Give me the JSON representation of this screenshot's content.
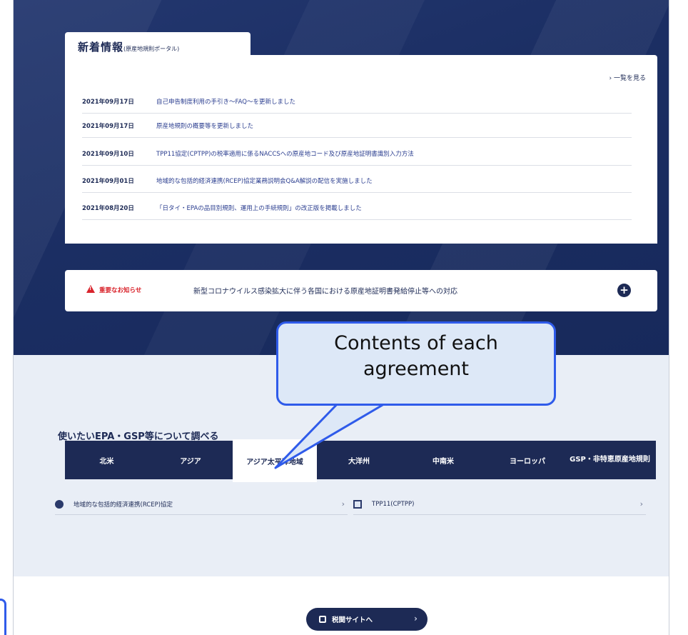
{
  "news": {
    "title": "新着情報",
    "subtitle": "(原産地規則ポータル)",
    "more_label": "› 一覧を見る",
    "items": [
      {
        "date": "2021年09月17日",
        "text": "自己申告制度利用の手引き～FAQ～を更新しました"
      },
      {
        "date": "2021年09月17日",
        "text": "原産地規則の概要等を更新しました"
      },
      {
        "date": "2021年09月10日",
        "text": "TPP11協定(CPTPP)の税率適用に係るNACCSへの原産地コード及び原産地証明書識別入力方法"
      },
      {
        "date": "2021年09月01日",
        "text": "地域的な包括的経済連携(RCEP)協定業務説明会Q&A解説の配信を実施しました"
      },
      {
        "date": "2021年08月20日",
        "text": "「日タイ・EPAの品目別規則、運用上の手続規則」の改正版を掲載しました"
      }
    ]
  },
  "notice": {
    "label": "重要なお知らせ",
    "text": "新型コロナウイルス感染拡大に伴う各国における原産地証明書発給停止等への対応",
    "plus": "+"
  },
  "epa": {
    "title": "使いたいEPA・GSP等について調べる",
    "tabs": [
      {
        "label": "北米"
      },
      {
        "label": "アジア"
      },
      {
        "label": "アジア太平洋地域"
      },
      {
        "label": "大洋州"
      },
      {
        "label": "中南米"
      },
      {
        "label": "ヨーロッパ"
      },
      {
        "label": "GSP・非特恵原産地規則"
      }
    ],
    "agreements": [
      {
        "label": "地域的な包括的経済連携(RCEP)協定",
        "chevron": "›"
      },
      {
        "label": "TPP11(CPTPP)",
        "chevron": "›"
      }
    ]
  },
  "footer": {
    "customs_button": "税関サイトへ",
    "customs_chevron": "›"
  },
  "callout": {
    "line1": "Contents of each",
    "line2": "agreement"
  },
  "colors": {
    "navy": "#1d2a55",
    "hero": "#1b2e63",
    "alert_red": "#d9242c",
    "callout_border": "#2f5bea",
    "callout_fill": "#dde8f7"
  }
}
